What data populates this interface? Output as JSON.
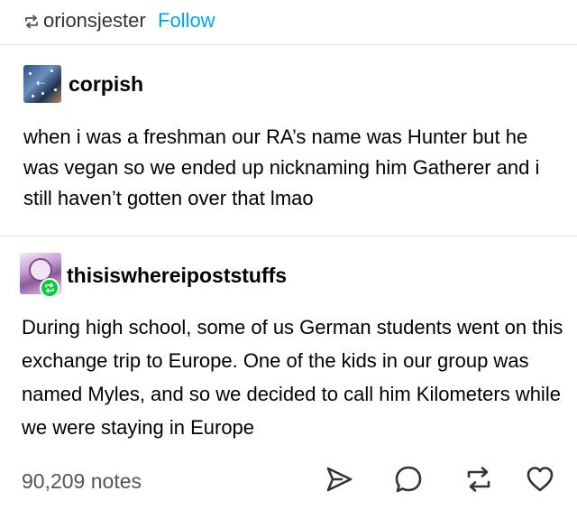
{
  "header": {
    "username": "orionsjester",
    "follow_label": "Follow",
    "reblog_icon": "reblog-icon",
    "link_color": "#00a8e8"
  },
  "posts": [
    {
      "username": "corpish",
      "body": "when i was a freshman our RA’s name was Hunter but he was vegan so we ended up nicknaming him Gatherer and i still haven’t gotten over that lmao"
    },
    {
      "username": "thisiswhereipoststuffs",
      "body": "During high school, some of us German students went on this exchange trip to Europe. One of the kids in our group was named Myles, and so we decided to call him Kilometers while we were staying in Europe",
      "badge_color": "#00cf35"
    }
  ],
  "footer": {
    "notes": "90,209 notes",
    "actions": [
      "share-icon",
      "reply-icon",
      "reblog-icon",
      "heart-icon"
    ]
  }
}
